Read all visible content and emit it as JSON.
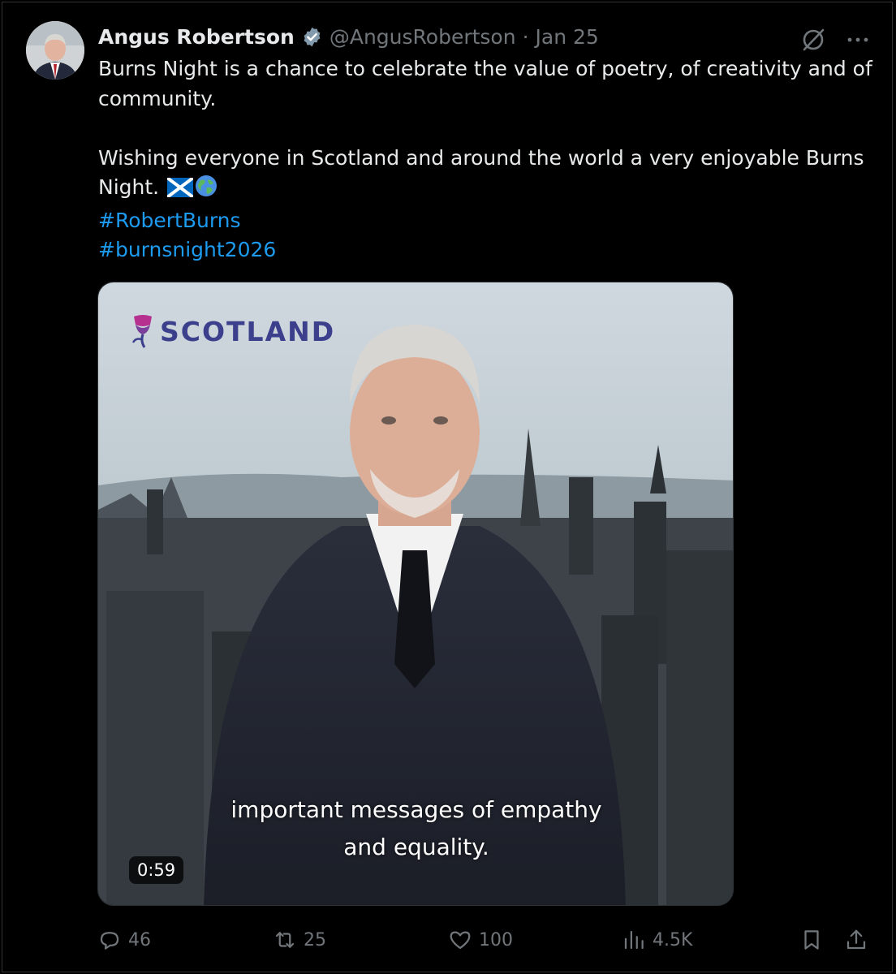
{
  "author": {
    "name": "Angus Robertson",
    "handle": "@AngusRobertson",
    "separator": "·",
    "date": "Jan 25"
  },
  "tweet": {
    "line1": "Burns Night is a chance to celebrate the value of poetry, of creativity and of community.",
    "line2": "Wishing everyone in Scotland and around the world a very enjoyable Burns Night.",
    "hashtags": [
      "#RobertBurns",
      "#burnsnight2026"
    ],
    "emojis": [
      "scotland-flag",
      "globe"
    ]
  },
  "media": {
    "logo_text": "SCOTLAND",
    "caption_line1": "important messages of empathy",
    "caption_line2": "and equality.",
    "duration": "0:59"
  },
  "actions": {
    "replies": "46",
    "reposts": "25",
    "likes": "100",
    "views": "4.5K"
  },
  "colors": {
    "background": "#000000",
    "text": "#e7e9ea",
    "muted": "#71767b",
    "link": "#1d9bf0",
    "verified": "#829aab"
  }
}
